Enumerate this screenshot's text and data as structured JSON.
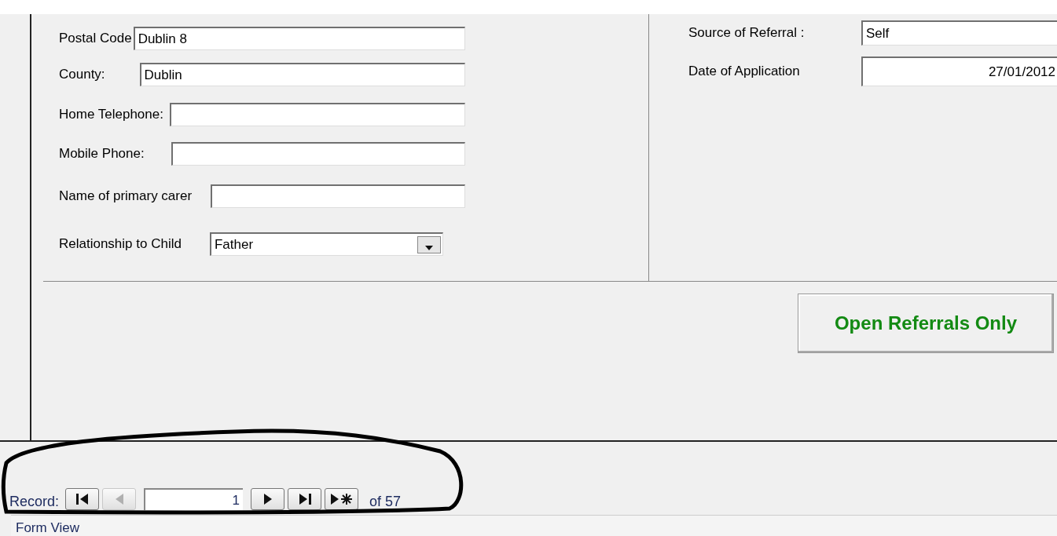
{
  "form": {
    "left_fields": [
      {
        "label": "Postal Code",
        "value": "Dublin 8",
        "kind": "text"
      },
      {
        "label": "County:",
        "value": "Dublin",
        "kind": "text"
      },
      {
        "label": "Home Telephone:",
        "kind": "text"
      },
      {
        "label": "Mobile Phone:",
        "kind": "text"
      },
      {
        "label": "Name of primary carer",
        "kind": "text"
      },
      {
        "label": "Relationship to Child",
        "value": "Father",
        "kind": "combo"
      }
    ],
    "right_fields": [
      {
        "label": "Source of Referral :",
        "value": "Self",
        "kind": "text"
      },
      {
        "label": "Date of Application",
        "value": "27/01/2012",
        "kind": "date"
      }
    ],
    "open_referrals_button": "Open Referrals Only"
  },
  "navigator": {
    "label": "Record:",
    "buttons": [
      {
        "kind": "first",
        "disabled": false
      },
      {
        "kind": "previous",
        "disabled": true
      },
      {
        "kind": "current"
      },
      {
        "kind": "next",
        "disabled": false
      },
      {
        "kind": "last",
        "disabled": false
      },
      {
        "kind": "new",
        "disabled": false
      }
    ],
    "current": "1",
    "total": "of 57"
  },
  "status_bar": "Form View"
}
